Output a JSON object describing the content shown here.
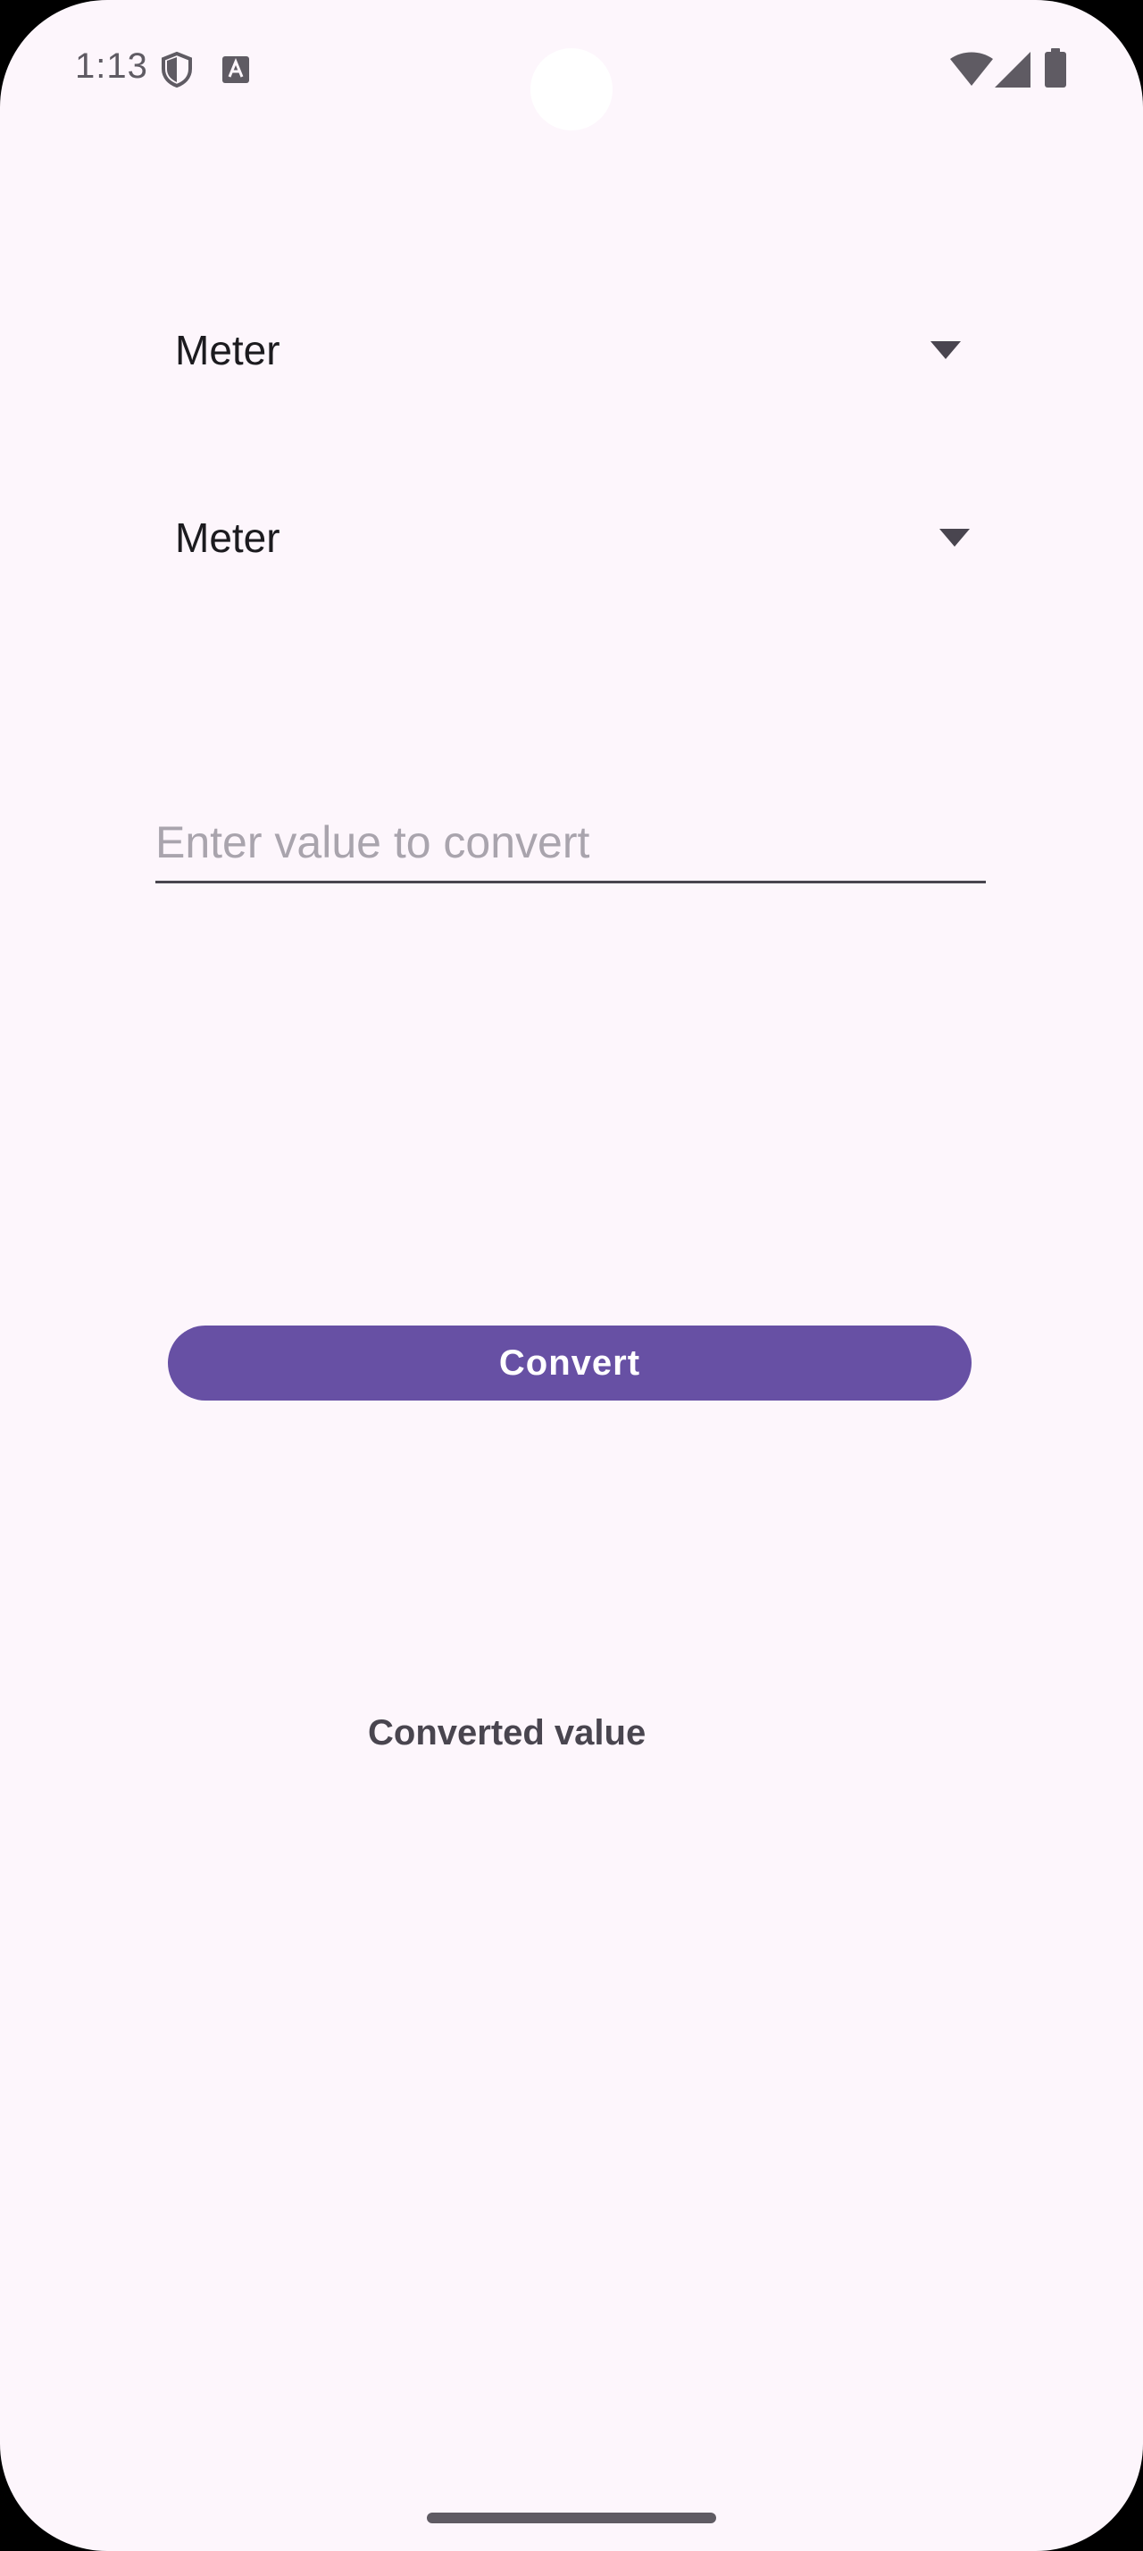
{
  "status_bar": {
    "time": "1:13",
    "icons": [
      "shield-icon",
      "a-icon",
      "wifi-icon",
      "signal-icon",
      "battery-icon"
    ]
  },
  "converter": {
    "from_unit": "Meter",
    "to_unit": "Meter",
    "input": {
      "value": "",
      "placeholder": "Enter value to convert"
    },
    "convert_label": "Convert",
    "result_label": "Converted value"
  },
  "colors": {
    "background": "#fdf6fc",
    "primary": "#6750a4",
    "on_primary": "#ffffff",
    "text": "#1c1b1f",
    "secondary_text": "#49454f",
    "placeholder": "#a9a4ad"
  }
}
